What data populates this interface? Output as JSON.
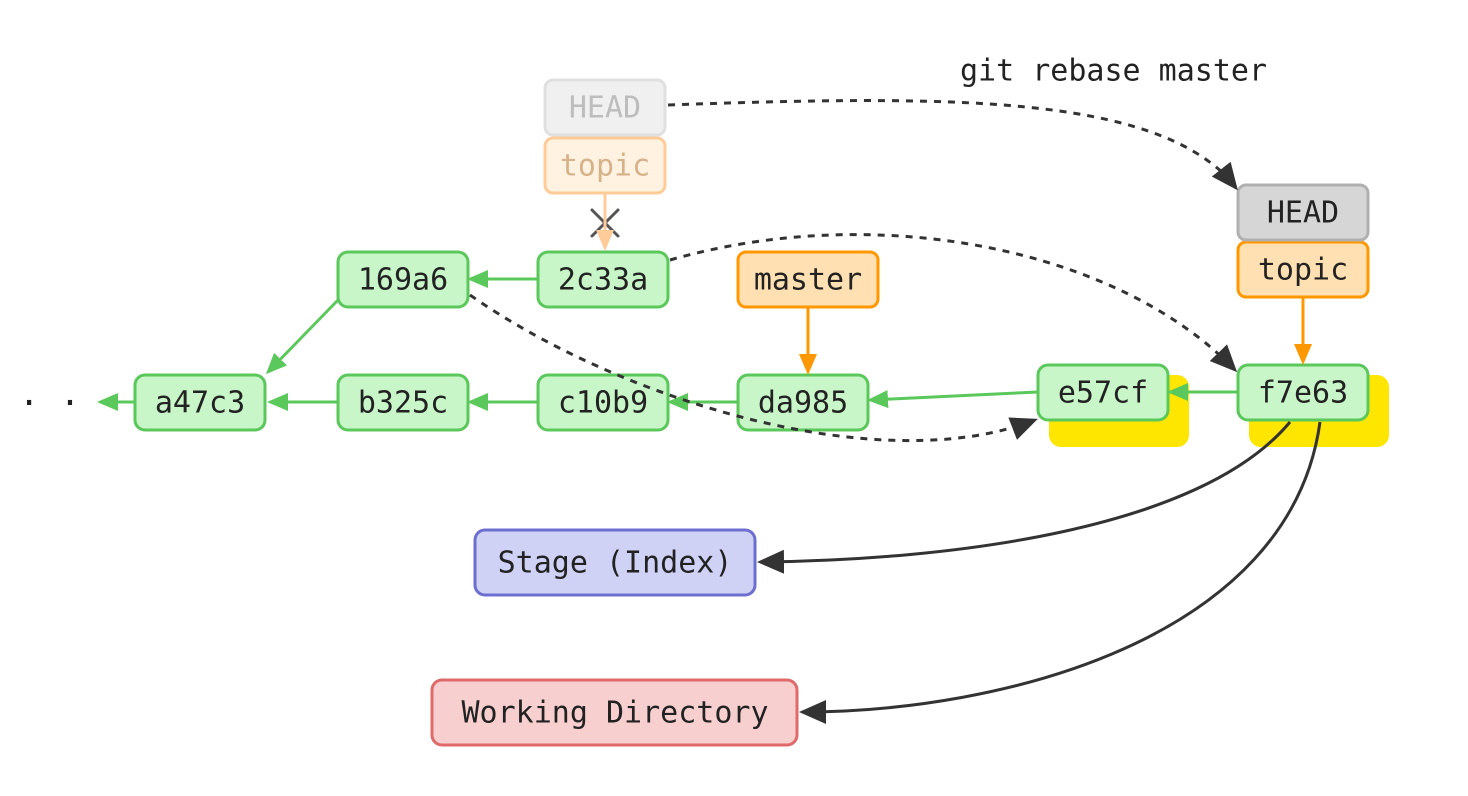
{
  "command": "git rebase master",
  "head_label": "HEAD",
  "branches": {
    "topic": "topic",
    "master": "master"
  },
  "commits": {
    "a47c3": "a47c3",
    "b325c": "b325c",
    "c10b9": "c10b9",
    "da985": "da985",
    "e57cf": "e57cf",
    "f7e63": "f7e63",
    "169a6": "169a6",
    "2c33a": "2c33a"
  },
  "stage_label": "Stage (Index)",
  "wd_label": "Working Directory",
  "ellipsis": "· · ·",
  "chart_data": {
    "type": "diagram",
    "description": "Git rebase diagram showing HEAD/topic moving from commit 2c33a onto master at da985, producing new commits e57cf and f7e63",
    "main_chain": [
      "a47c3",
      "b325c",
      "c10b9",
      "da985",
      "e57cf",
      "f7e63"
    ],
    "old_topic_chain": [
      "b325c",
      "169a6",
      "2c33a"
    ],
    "branches": {
      "master": "da985",
      "topic_old": "2c33a",
      "topic_new": "f7e63"
    },
    "head_old": "topic (at 2c33a)",
    "head_new": "topic (at f7e63)",
    "rebased_pairs": [
      {
        "from": "169a6",
        "to": "e57cf"
      },
      {
        "from": "2c33a",
        "to": "f7e63"
      }
    ],
    "updates_from_f7e63": [
      "Stage (Index)",
      "Working Directory"
    ]
  }
}
